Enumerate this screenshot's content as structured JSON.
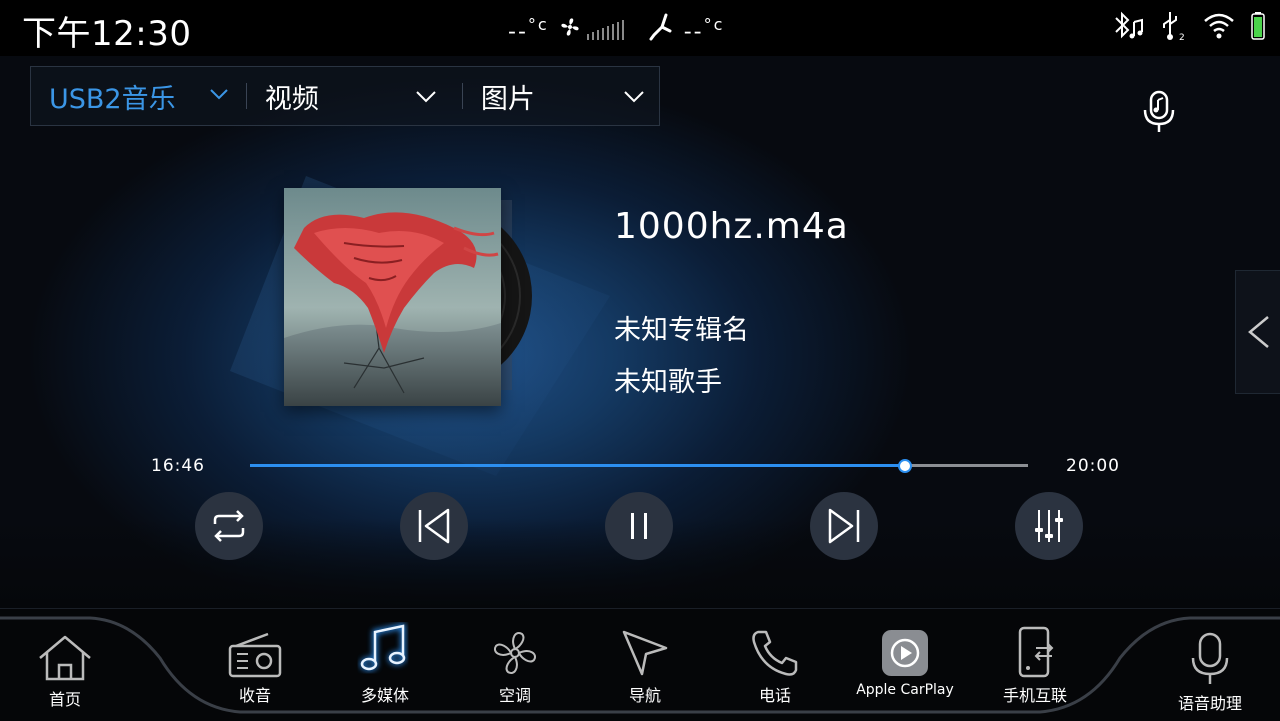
{
  "status": {
    "time": "下午12:30",
    "temp_left": "--",
    "temp_right": "--",
    "temp_unit": "°c"
  },
  "tabs": [
    {
      "label": "USB2音乐",
      "active": true
    },
    {
      "label": "视频",
      "active": false
    },
    {
      "label": "图片",
      "active": false
    }
  ],
  "track": {
    "title": "1000hz.m4a",
    "album": "未知专辑名",
    "artist": "未知歌手",
    "elapsed": "16:46",
    "total": "20:00",
    "progress": 0.84
  },
  "controls": [
    "repeat-icon",
    "previous-icon",
    "pause-icon",
    "next-icon",
    "equalizer-icon"
  ],
  "dock": [
    {
      "label": "首页",
      "icon": "home-icon"
    },
    {
      "label": "收音",
      "icon": "radio-icon"
    },
    {
      "label": "多媒体",
      "icon": "music-note-icon",
      "active": true
    },
    {
      "label": "空调",
      "icon": "fan-icon"
    },
    {
      "label": "导航",
      "icon": "navigation-icon"
    },
    {
      "label": "电话",
      "icon": "phone-icon"
    },
    {
      "label": "Apple CarPlay",
      "icon": "carplay-icon"
    },
    {
      "label": "手机互联",
      "icon": "phone-link-icon"
    },
    {
      "label": "语音助理",
      "icon": "microphone-icon"
    }
  ],
  "colors": {
    "accent": "#2c8ff0",
    "tab_active": "#3b96e6",
    "background": "#07090d"
  }
}
